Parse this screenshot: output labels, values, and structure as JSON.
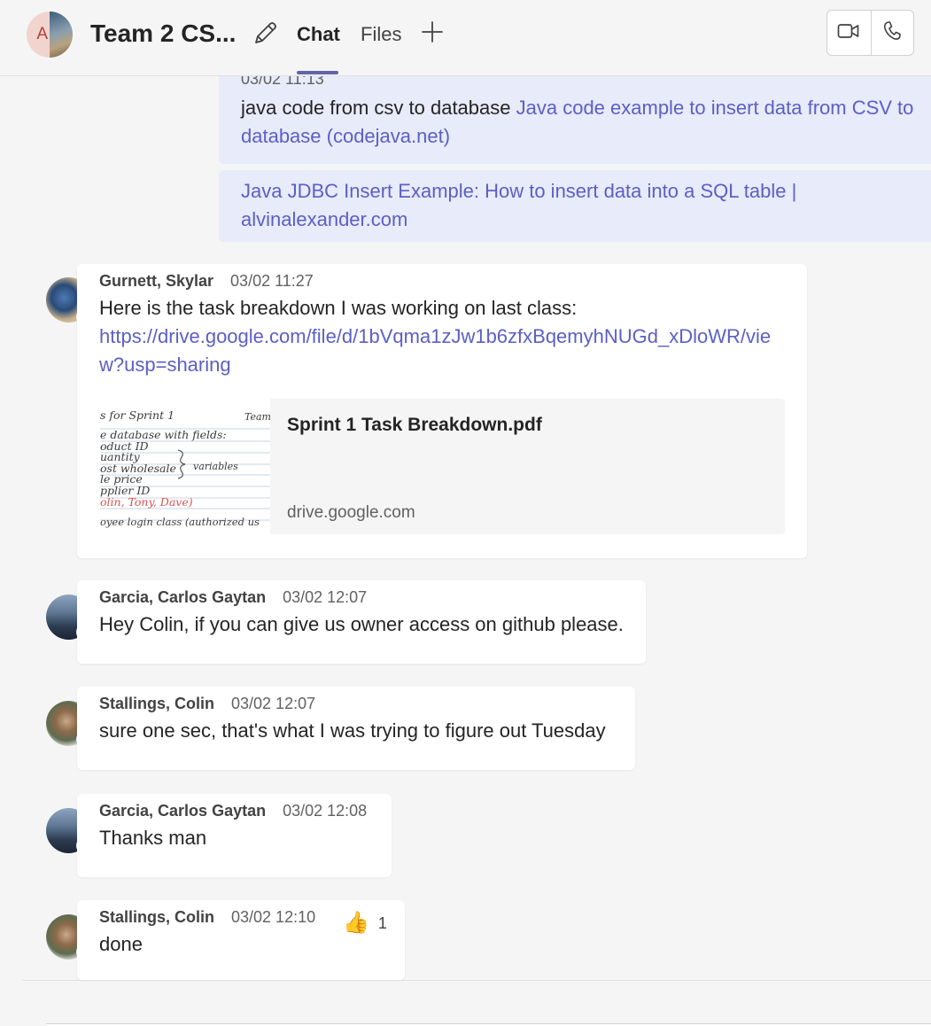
{
  "header": {
    "avatar_initial": "A",
    "title": "Team 2 CS...",
    "tabs": [
      {
        "label": "Chat",
        "selected": true
      },
      {
        "label": "Files",
        "selected": false
      }
    ],
    "icons": [
      "edit-icon",
      "plus-icon",
      "video-call-icon",
      "audio-call-icon"
    ],
    "accent_color": "#6264a7"
  },
  "own_messages": [
    {
      "timestamp": "03/02 11:13",
      "text": "java code from csv to database ",
      "link": "Java code example to insert data from CSV to database (codejava.net)"
    },
    {
      "link": "Java JDBC Insert Example: How to insert data into a SQL table | alvinalexander.com"
    }
  ],
  "messages": [
    {
      "sender": "Gurnett, Skylar",
      "timestamp": "03/02 11:27",
      "status": "away",
      "text": "Here is the task breakdown I was working on last class:",
      "link": "https://drive.google.com/file/d/1bVqma1zJw1b6zfxBqemyhNUGd_xDloWR/view?usp=sharing",
      "preview": {
        "title": "Sprint 1 Task Breakdown.pdf",
        "domain": "drive.google.com",
        "thumbnail_lines": [
          "s for Sprint 1",
          "Team",
          "e database with fields:",
          "oduct ID",
          "uantity",
          "ost wholesale",
          "variables",
          "le price",
          "pplier ID",
          "olin, Tony, Dave)",
          "oyee login class (authorized us"
        ]
      }
    },
    {
      "sender": "Garcia, Carlos Gaytan",
      "timestamp": "03/02 12:07",
      "status": "away",
      "text": "Hey Colin, if you can give us owner access on github please."
    },
    {
      "sender": "Stallings, Colin",
      "timestamp": "03/02 12:07",
      "status": "available",
      "text": "sure one sec, that's what I was trying to figure out Tuesday"
    },
    {
      "sender": "Garcia, Carlos Gaytan",
      "timestamp": "03/02 12:08",
      "status": "away",
      "text": "Thanks man"
    },
    {
      "sender": "Stallings, Colin",
      "timestamp": "03/02 12:10",
      "status": "available",
      "text": "done",
      "reaction": {
        "emoji": "👍",
        "count": "1"
      }
    }
  ],
  "colors": {
    "link": "#5b5fc7",
    "own_bubble": "#e8ebfa",
    "away": "#f8d22a",
    "available": "#6bb700"
  }
}
